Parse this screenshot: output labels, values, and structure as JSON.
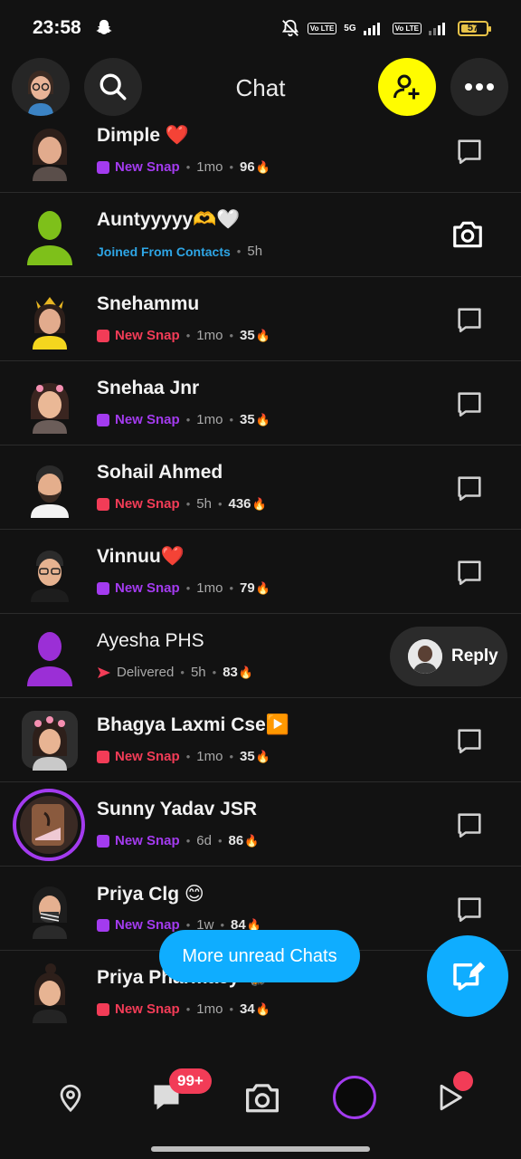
{
  "status_bar": {
    "time": "23:58",
    "network_5g": "5G",
    "lte_label": "Vo LTE",
    "battery": "57"
  },
  "header": {
    "title": "Chat"
  },
  "chats": [
    {
      "name": "Dimple ❤️",
      "status": "New Snap",
      "status_color": "purple",
      "time": "1mo",
      "streak": "96"
    },
    {
      "name": "Auntyyyyy🫶🤍",
      "status": "Joined From Contacts",
      "status_color": "blue",
      "time": "5h",
      "streak": ""
    },
    {
      "name": "Snehammu",
      "status": "New Snap",
      "status_color": "red",
      "time": "1mo",
      "streak": "35"
    },
    {
      "name": "Snehaa Jnr",
      "status": "New Snap",
      "status_color": "purple",
      "time": "1mo",
      "streak": "35"
    },
    {
      "name": "Sohail Ahmed",
      "status": "New Snap",
      "status_color": "red",
      "time": "5h",
      "streak": "436"
    },
    {
      "name": "Vinnuu❤️",
      "status": "New Snap",
      "status_color": "purple",
      "time": "1mo",
      "streak": "79"
    },
    {
      "name": "Ayesha PHS",
      "status": "Delivered",
      "status_color": "grey",
      "time": "5h",
      "streak": "83"
    },
    {
      "name": "Bhagya Laxmi Cse▶️",
      "status": "New Snap",
      "status_color": "red",
      "time": "1mo",
      "streak": "35"
    },
    {
      "name": "Sunny Yadav JSR",
      "status": "New Snap",
      "status_color": "purple",
      "time": "6d",
      "streak": "86"
    },
    {
      "name": "Priya Clg 😊",
      "status": "New Snap",
      "status_color": "purple",
      "time": "1w",
      "streak": "84"
    },
    {
      "name": "Priya Pharmacy 🦋",
      "status": "New Snap",
      "status_color": "red",
      "time": "1mo",
      "streak": "34"
    }
  ],
  "reply_label": "Reply",
  "more_unread": "More unread Chats",
  "nav": {
    "chat_badge": "99+"
  },
  "colors": {
    "background": "#121212",
    "snap_purple": "#a33bef",
    "snap_red": "#f23c57",
    "accent_blue": "#0fadff",
    "add_friend_yellow": "#fffc00"
  },
  "icons": {
    "streak": "fire-emoji",
    "fire_glyph": "🔥"
  }
}
